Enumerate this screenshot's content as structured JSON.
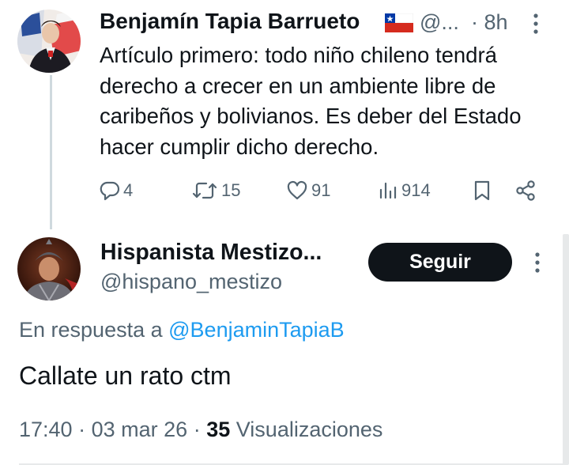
{
  "parent_tweet": {
    "author_name": "Benjamín Tapia Barrueto",
    "flag": "chile-flag-icon",
    "handle": "@...",
    "time": "· 8h",
    "text": "Artículo primero: todo niño chileno tendrá derecho a crecer en un ambiente libre de caribeños y bolivianos. Es deber del Estado hacer cumplir dicho derecho.",
    "actions": {
      "replies": "4",
      "reposts": "15",
      "likes": "91",
      "views": "914"
    }
  },
  "reply_tweet": {
    "author_name": "Hispanista Mestizo...",
    "handle": "@hispano_mestizo",
    "follow_label": "Seguir",
    "reply_prefix": "En respuesta a",
    "reply_mention": "@BenjaminTapiaB",
    "text": "Callate un rato ctm",
    "time": "17:40",
    "date": "03 mar 26",
    "views_count": "35",
    "views_label": "Visualizaciones"
  },
  "colors": {
    "text": "#0f1419",
    "secondary": "#536471",
    "link": "#1d9bf0",
    "button_bg": "#0f1419"
  }
}
